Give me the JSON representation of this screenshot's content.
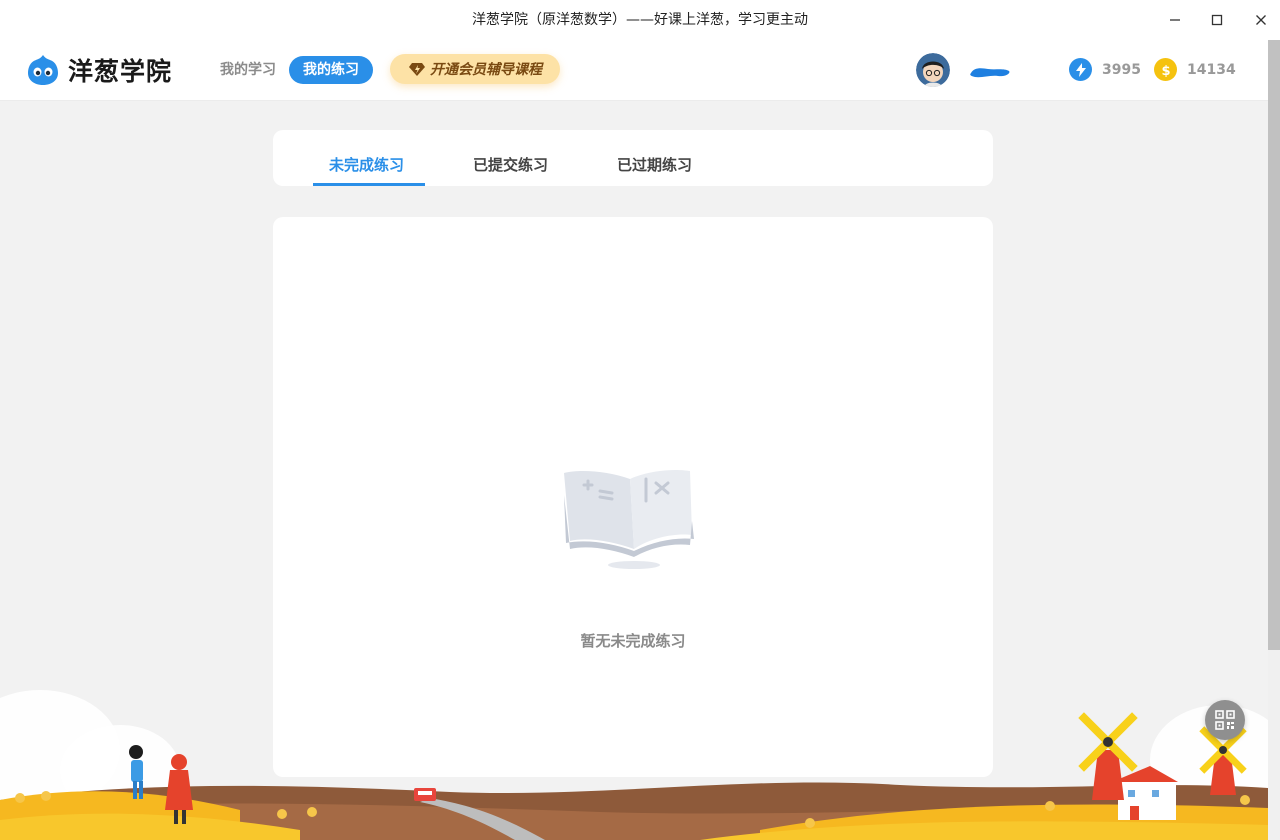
{
  "window": {
    "title": "洋葱学院（原洋葱数学）——好课上洋葱，学习更主动"
  },
  "header": {
    "logo_text": "洋葱学院",
    "nav": [
      {
        "label": "我的学习",
        "active": false
      },
      {
        "label": "我的练习",
        "active": true
      }
    ],
    "vip_label": "开通会员辅导课程",
    "energy": "3995",
    "coins": "14134"
  },
  "tabs": [
    {
      "label": "未完成练习",
      "active": true
    },
    {
      "label": "已提交练习",
      "active": false
    },
    {
      "label": "已过期练习",
      "active": false
    }
  ],
  "empty_state": {
    "text": "暂无未完成练习"
  },
  "colors": {
    "accent": "#2a8fe8",
    "vip_bg": "#fde2a6",
    "energy": "#2a8fe8",
    "coin": "#f5c20f"
  }
}
